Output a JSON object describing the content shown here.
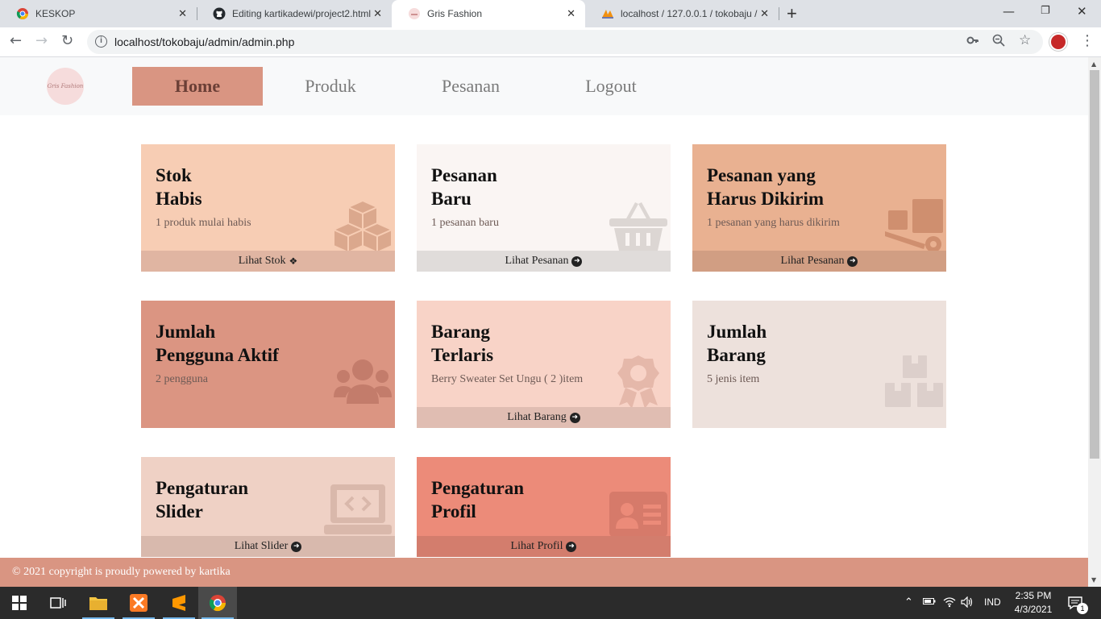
{
  "browser": {
    "tabs": [
      {
        "title": "KESKOP"
      },
      {
        "title": "Editing kartikadewi/project2.html"
      },
      {
        "title": "Gris Fashion"
      },
      {
        "title": "localhost / 127.0.0.1 / tokobaju / "
      }
    ],
    "url": "localhost/tokobaju/admin/admin.php",
    "new_tab": "+"
  },
  "navbar": {
    "logo_text": "Gris Fashion",
    "links": [
      "Home",
      "Produk",
      "Pesanan",
      "Logout"
    ],
    "active": "Home"
  },
  "cards": [
    {
      "title_1": "Stok",
      "title_2": "Habis",
      "subtitle": "1 produk mulai habis",
      "footer": "Lihat Stok",
      "icon": "cubes-icon",
      "bg": "#f7cdb4",
      "footer_bg": "#e0b5a2"
    },
    {
      "title_1": "Pesanan",
      "title_2": "Baru",
      "subtitle": "1 pesanan baru",
      "footer": "Lihat Pesanan",
      "icon": "basket-icon",
      "bg": "#faf5f3",
      "footer_bg": "#e0dcda"
    },
    {
      "title_1": "Pesanan yang",
      "title_2": "Harus Dikirim",
      "subtitle": "1 pesanan yang harus dikirim",
      "footer": "Lihat Pesanan",
      "icon": "dolly-icon",
      "bg": "#e9b191",
      "footer_bg": "#d19e83"
    },
    {
      "title_1": "Jumlah",
      "title_2": "Pengguna Aktif",
      "subtitle": "2 pengguna",
      "footer": "",
      "icon": "users-icon",
      "bg": "#db9582",
      "footer_bg": ""
    },
    {
      "title_1": "Barang",
      "title_2": "Terlaris",
      "subtitle": "Berry Sweater Set Ungu ( 2 )item",
      "footer": "Lihat Barang",
      "icon": "award-icon",
      "bg": "#f8d3c7",
      "footer_bg": "#e0bdb2"
    },
    {
      "title_1": "Jumlah",
      "title_2": "Barang",
      "subtitle": "5 jenis item",
      "footer": "",
      "icon": "boxes-icon",
      "bg": "#ede1dc",
      "footer_bg": ""
    },
    {
      "title_1": "Pengaturan",
      "title_2": "Slider",
      "subtitle": "",
      "footer": "Lihat Slider",
      "icon": "laptop-code-icon",
      "bg": "#efd1c5",
      "footer_bg": "#d8b9ad"
    },
    {
      "title_1": "Pengaturan",
      "title_2": "Profil",
      "subtitle": "",
      "footer": "Lihat Profil",
      "icon": "id-card-icon",
      "bg": "#ec8b79",
      "footer_bg": "#d37d6d"
    }
  ],
  "footer": {
    "text": "© 2021 copyright is proudly powered by kartika"
  },
  "taskbar": {
    "language": "IND",
    "time": "2:35 PM",
    "date": "4/3/2021",
    "notification_count": "1"
  }
}
